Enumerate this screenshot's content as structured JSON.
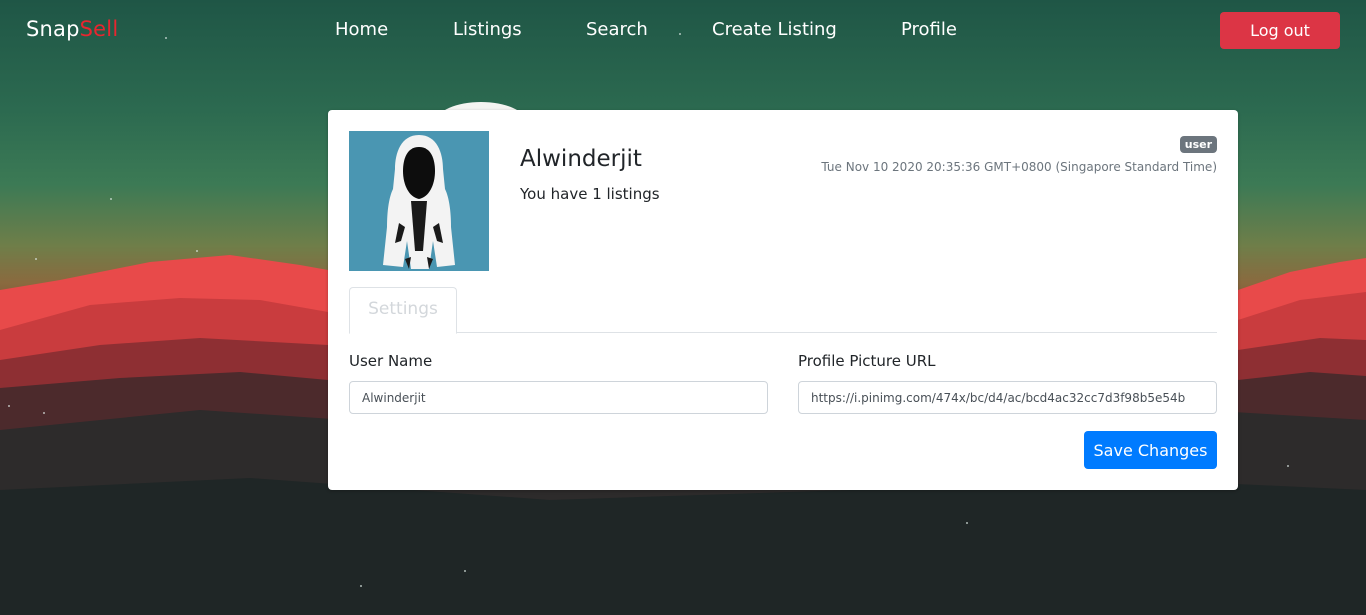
{
  "brand": {
    "name_part1": "Snap",
    "name_part2": "Sell"
  },
  "nav": {
    "home": "Home",
    "listings": "Listings",
    "search": "Search",
    "create_listing": "Create Listing",
    "profile": "Profile"
  },
  "logout_label": "Log out",
  "profile_card": {
    "username": "Alwinderjit",
    "listings_text": "You have 1 listings",
    "role_badge": "user",
    "joined": "Tue Nov 10 2020 20:35:36 GMT+0800 (Singapore Standard Time)",
    "avatar_icon": "hooded-figure-avatar"
  },
  "tabs": {
    "settings": "Settings"
  },
  "form": {
    "username_label": "User Name",
    "username_value": "Alwinderjit",
    "picture_label": "Profile Picture URL",
    "picture_value": "https://i.pinimg.com/474x/bc/d4/ac/bcd4ac32cc7d3f98b5e54b",
    "save_label": "Save Changes"
  },
  "colors": {
    "brand_accent": "#e8262f",
    "logout": "#dc3545",
    "primary": "#007bff",
    "badge": "#6c757d"
  }
}
